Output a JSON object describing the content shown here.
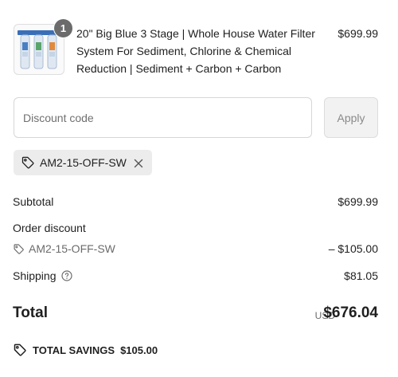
{
  "product": {
    "quantity": "1",
    "name": "20\" Big Blue 3 Stage | Whole House Water Filter System For Sediment, Chlorine & Chemical Reduction | Sediment + Carbon + Carbon",
    "price": "$699.99"
  },
  "discount": {
    "placeholder": "Discount code",
    "apply_label": "Apply",
    "applied_code": "AM2-15-OFF-SW"
  },
  "summary": {
    "subtotal_label": "Subtotal",
    "subtotal_value": "$699.99",
    "order_discount_label": "Order discount",
    "order_discount_code": "AM2-15-OFF-SW",
    "order_discount_value": "– $105.00",
    "shipping_label": "Shipping",
    "shipping_value": "$81.05",
    "total_label": "Total",
    "total_currency": "USD",
    "total_value": "$676.04",
    "savings_label": "TOTAL SAVINGS",
    "savings_value": "$105.00"
  },
  "icons": {
    "tag": "tag-icon",
    "close": "close-icon",
    "info": "info-icon"
  },
  "colors": {
    "badge": "#6b6b6b",
    "chip_background": "#ececec",
    "apply_button_bg": "#f2f2f2"
  }
}
